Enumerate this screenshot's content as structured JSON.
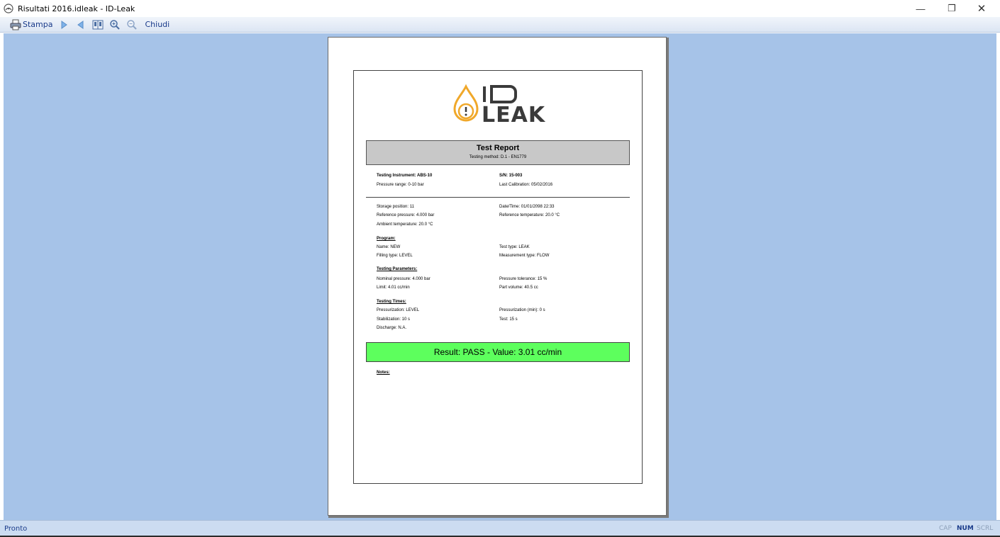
{
  "window": {
    "title": "Risultati 2016.idleak - ID-Leak",
    "minimize": "—",
    "maximize": "❐",
    "close": "✕"
  },
  "toolbar": {
    "print_label": "Stampa",
    "close_label": "Chiudi"
  },
  "report": {
    "logo_top": "I",
    "logo_bottom": "LEAK",
    "title": "Test Report",
    "method": "Testing method: D.1 - EN1779",
    "instrument": "Testing Instrument: ABS-10",
    "serial": "S/N: 15-003",
    "pressure_range": "Pressure range: 0-10 bar",
    "last_calibration": "Last Calibration: 05/02/2016",
    "storage_position": "Storage position: 11",
    "datetime": "Date/Time: 01/01/2098 22:33",
    "reference_pressure": "Reference pressure: 4.000 bar",
    "reference_temperature": "Reference temperature: 20.0  °C",
    "ambient_temperature": "Ambient temperature: 20.0 °C",
    "program_heading": "Program:",
    "program_name": "Name: NEW",
    "test_type": "Test type: LEAK",
    "filling_type": "Filling type: LEVEL",
    "measurement_type": "Measurement type: FLOW",
    "parameters_heading": "Testing Parameters:",
    "nominal_pressure": "Nominal pressure: 4.000 bar",
    "pressure_tolerance": "Pressure tolerance: 15 %",
    "limit": "Limit: 4.01 cc/min",
    "part_volume": "Part volume: 40.5 cc",
    "times_heading": "Testing Times:",
    "pressurization": "Pressurization: LEVEL",
    "pressurization_min": "Pressurization (min): 0 s",
    "stabilization": "Stabilization: 10 s",
    "test_time": "Test: 15 s",
    "discharge": "Discharge: N.A.",
    "result": "Result: PASS - Value: 3.01 cc/min",
    "notes_heading": "Notes:"
  },
  "status": {
    "text": "Pronto",
    "cap": "CAP",
    "num": "NUM",
    "scrl": "SCRL"
  },
  "colors": {
    "workspace": "#a6c3e8",
    "result_pass": "#5dff5d",
    "header_box": "#c8c8c8",
    "logo_orange": "#f0a82a",
    "logo_dark": "#3a3a3a"
  },
  "icons": [
    "app-icon",
    "printer-icon",
    "next-page-icon",
    "prev-page-icon",
    "two-pages-icon",
    "zoom-in-icon",
    "zoom-out-icon"
  ]
}
